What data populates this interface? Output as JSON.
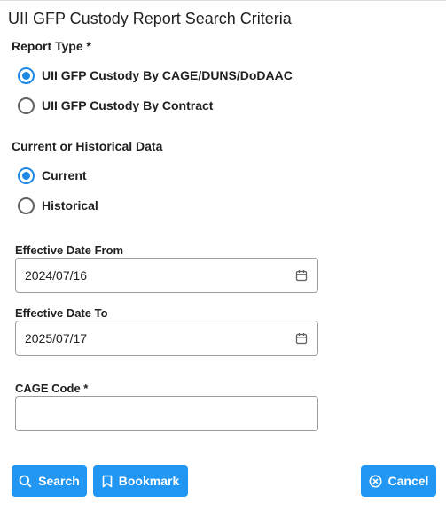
{
  "page": {
    "title": "UII GFP Custody Report Search Criteria"
  },
  "report_type": {
    "label": "Report Type *",
    "options": [
      {
        "label": "UII GFP Custody By CAGE/DUNS/DoDAAC",
        "selected": true
      },
      {
        "label": "UII GFP Custody By Contract",
        "selected": false
      }
    ]
  },
  "data_scope": {
    "label": "Current or Historical Data",
    "options": [
      {
        "label": "Current",
        "selected": true
      },
      {
        "label": "Historical",
        "selected": false
      }
    ]
  },
  "effective_date_from": {
    "label": "Effective Date From",
    "value": "2024/07/16",
    "icon": "calendar-icon"
  },
  "effective_date_to": {
    "label": "Effective Date To",
    "value": "2025/07/17",
    "icon": "calendar-icon"
  },
  "cage_code": {
    "label": "CAGE Code *",
    "value": ""
  },
  "actions": {
    "search_label": "Search",
    "search_icon": "search-icon",
    "bookmark_label": "Bookmark",
    "bookmark_icon": "bookmark-icon",
    "cancel_label": "Cancel",
    "cancel_icon": "cancel-circle-icon"
  },
  "colors": {
    "accent": "#2196f3",
    "radio_selected": "#1e88e5",
    "text": "#212121",
    "border": "#9e9e9e"
  }
}
